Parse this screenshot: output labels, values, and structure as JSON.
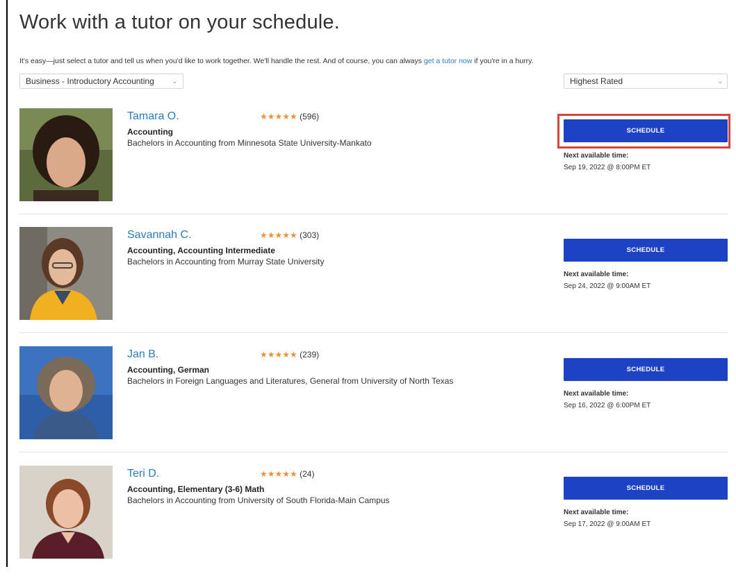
{
  "page": {
    "title": "Work with a tutor on your schedule.",
    "intro_before": "It's easy—just select a tutor and tell us when you'd like to work together. We'll handle the rest. And of course, you can always ",
    "intro_link": "get a tutor now",
    "intro_after": " if you're in a hurry."
  },
  "filters": {
    "subject": "Business - Introductory Accounting",
    "sort": "Highest Rated"
  },
  "colors": {
    "accent_blue": "#1d43c4",
    "link_blue": "#2a7dc4",
    "star_orange": "#f0913a",
    "highlight_red": "#d9443a"
  },
  "tutors": [
    {
      "name": "Tamara O.",
      "stars": "★★★★★",
      "reviews": "(596)",
      "subjects": "Accounting",
      "degree": "Bachelors in Accounting from Minnesota State University-Mankato",
      "button": "SCHEDULE",
      "next_label": "Next available time:",
      "next_time": "Sep 19, 2022 @ 8:00PM ET"
    },
    {
      "name": "Savannah C.",
      "stars": "★★★★★",
      "reviews": "(303)",
      "subjects": "Accounting, Accounting Intermediate",
      "degree": "Bachelors in Accounting from Murray State University",
      "button": "SCHEDULE",
      "next_label": "Next available time:",
      "next_time": "Sep 24, 2022 @ 9:00AM ET"
    },
    {
      "name": "Jan B.",
      "stars": "★★★★★",
      "reviews": "(239)",
      "subjects": "Accounting, German",
      "degree": "Bachelors in Foreign Languages and Literatures, General from University of North Texas",
      "button": "SCHEDULE",
      "next_label": "Next available time:",
      "next_time": "Sep 16, 2022 @ 6:00PM ET"
    },
    {
      "name": "Teri D.",
      "stars": "★★★★★",
      "reviews": "(24)",
      "subjects": "Accounting, Elementary (3-6) Math",
      "degree": "Bachelors in Accounting from University of South Florida-Main Campus",
      "button": "SCHEDULE",
      "next_label": "Next available time:",
      "next_time": "Sep 17, 2022 @ 9:00AM ET"
    }
  ]
}
